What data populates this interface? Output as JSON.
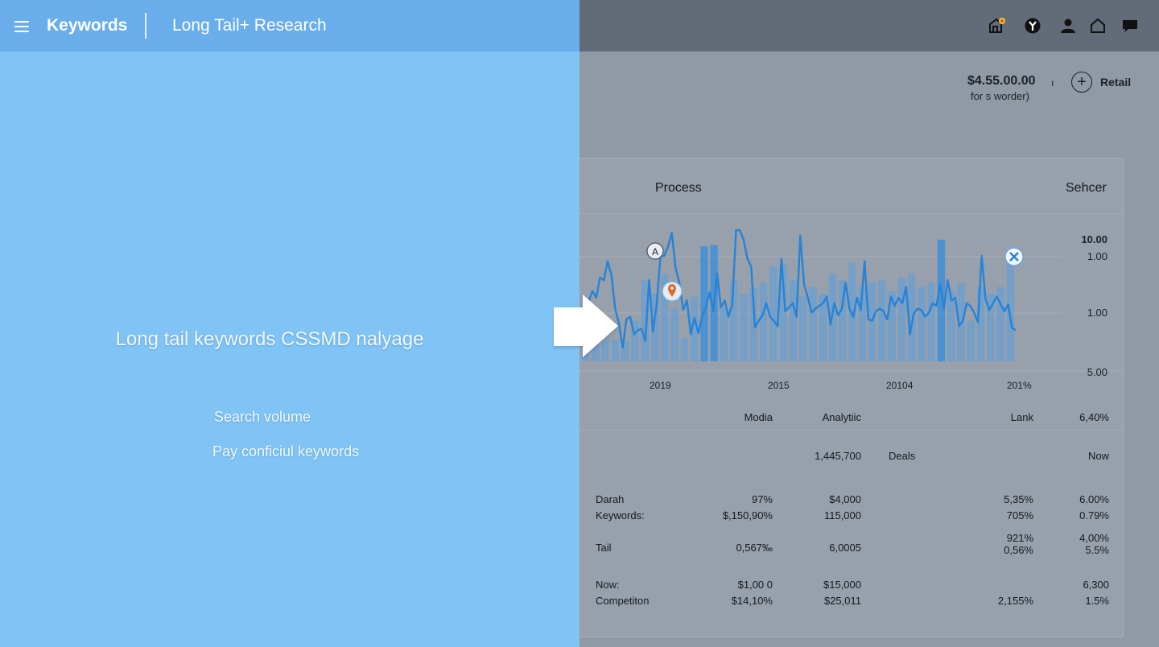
{
  "header": {
    "app_title": "Keywords",
    "page_title": "Long Tail+ Research"
  },
  "left": {
    "hero": "Long tail keywords CSSMD nalyage",
    "links": [
      "Search volume",
      "Pay conficiul keywords"
    ]
  },
  "top_icons": [
    "store-icon",
    "filter-icon",
    "user-icon",
    "home-icon",
    "chat-icon"
  ],
  "summary": {
    "price": "$4.55.00.00",
    "note": "for s worder)",
    "tick": "ı",
    "retail_label": "Retail"
  },
  "card": {
    "title_left": "Process",
    "title_right": "Sehcer"
  },
  "markers": {
    "a_label": "A"
  },
  "chart_data": {
    "type": "line",
    "x_tick_labels": [
      "2019",
      "2015",
      "20104",
      "201%"
    ],
    "y_tick_labels": [
      "10.00",
      "1.00",
      "1.00",
      "5.00"
    ],
    "line_values": [
      0.15,
      0.26,
      0.44,
      0.52,
      0.47,
      0.62,
      0.6,
      0.74,
      0.64,
      0.39,
      0.28,
      0.1,
      0.31,
      0.33,
      0.2,
      0.23,
      0.24,
      0.15,
      0.6,
      0.22,
      0.42,
      0.78,
      0.78,
      0.85,
      0.95,
      0.69,
      0.58,
      0.38,
      0.45,
      0.2,
      0.32,
      0.21,
      0.33,
      0.4,
      0.51,
      0.37,
      0.65,
      0.4,
      0.45,
      0.33,
      0.42,
      0.97,
      0.97,
      0.9,
      0.76,
      0.7,
      0.25,
      0.3,
      0.34,
      0.43,
      0.33,
      0.3,
      0.26,
      0.76,
      0.37,
      0.4,
      0.43,
      0.33,
      0.93,
      0.57,
      0.47,
      0.36,
      0.39,
      0.41,
      0.43,
      0.48,
      0.27,
      0.43,
      0.34,
      0.39,
      0.58,
      0.39,
      0.33,
      0.47,
      0.38,
      0.74,
      0.31,
      0.3,
      0.37,
      0.39,
      0.37,
      0.31,
      0.48,
      0.41,
      0.47,
      0.43,
      0.55,
      0.2,
      0.35,
      0.39,
      0.38,
      0.33,
      0.36,
      0.43,
      0.41,
      0.57,
      0.39,
      0.6,
      0.45,
      0.47,
      0.26,
      0.3,
      0.43,
      0.41,
      0.36,
      0.29,
      0.78,
      0.46,
      0.38,
      0.43,
      0.48,
      0.42,
      0.37,
      0.42,
      0.25,
      0.23
    ],
    "bar_values": [
      0.13,
      0.15,
      0.16,
      0.16,
      0.15,
      0.3,
      0.6,
      0.5,
      0.65,
      0.39,
      0.17,
      0.48,
      0.85,
      0.86,
      0.4,
      0.6,
      0.5,
      0.54,
      0.58,
      0.7,
      0.72,
      0.6,
      0.48,
      0.55,
      0.5,
      0.65,
      0.6,
      0.73,
      0.55,
      0.58,
      0.6,
      0.52,
      0.62,
      0.65,
      0.55,
      0.58,
      0.9,
      0.52,
      0.58,
      0.3,
      0.55,
      0.5,
      0.55,
      0.8
    ]
  },
  "table": {
    "col_headers": [
      "Modia",
      "Analytiic",
      "Lank",
      "6,40%"
    ],
    "summary_row": {
      "value": "1,445,700",
      "deals": "Deals",
      "now": "Now"
    },
    "rows": [
      {
        "label": "Darah",
        "c1": "97%",
        "c2": "$4,000",
        "c3": "5,35%",
        "c4": "6.00%"
      },
      {
        "label": "Keywords:",
        "c1": "$,150,90%",
        "c2": "115,000",
        "c3": "705%",
        "c4": "0.79%"
      },
      {
        "label": "",
        "c1": "",
        "c2": "",
        "c3": "921%",
        "c4": "4,00%"
      },
      {
        "label": "Tail",
        "c1": "0,567‰",
        "c2": "6,0005",
        "c3": "0,56%",
        "c4": "5.5%"
      },
      {
        "label": "Now:",
        "c1": "$1,00 0",
        "c2": "$15,000",
        "c3": "",
        "c4": "6,300"
      },
      {
        "label": "Competiton",
        "c1": "$14,10%",
        "c2": "$25,011",
        "c3": "2,155%",
        "c4": "1.5%"
      }
    ]
  }
}
